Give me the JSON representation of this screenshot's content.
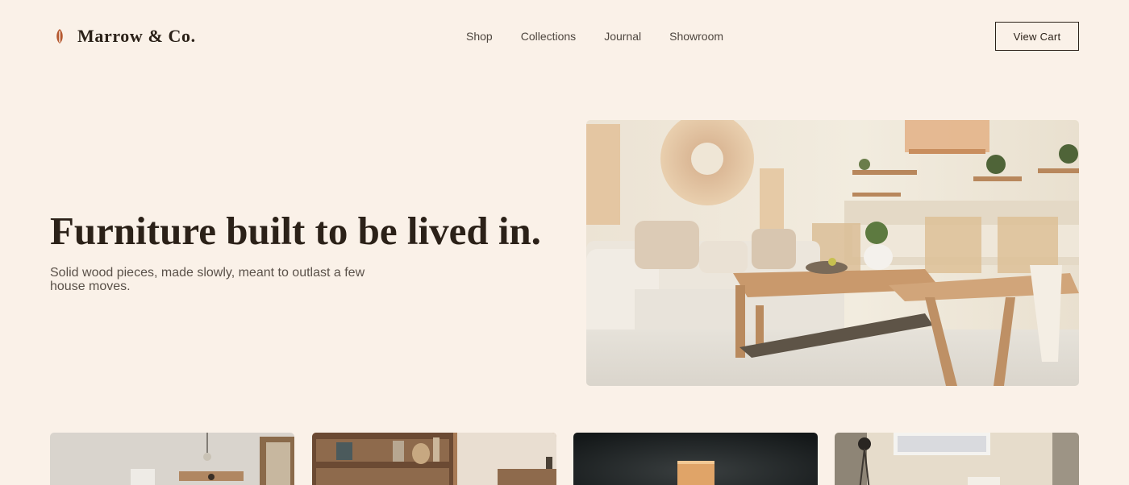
{
  "brand": {
    "name": "Marrow & Co.",
    "icon": "leaf-icon",
    "accent_color": "#b5582f"
  },
  "nav": {
    "items": [
      {
        "label": "Shop"
      },
      {
        "label": "Collections"
      },
      {
        "label": "Journal"
      },
      {
        "label": "Showroom"
      }
    ]
  },
  "header": {
    "cart_label": "View Cart"
  },
  "hero": {
    "title": "Furniture built to be lived in.",
    "subtitle": "Solid wood pieces, made slowly, meant to outlast a few house moves."
  },
  "colors": {
    "background": "#faf1e8",
    "text": "#2b2118",
    "muted_text": "#5a5149"
  }
}
